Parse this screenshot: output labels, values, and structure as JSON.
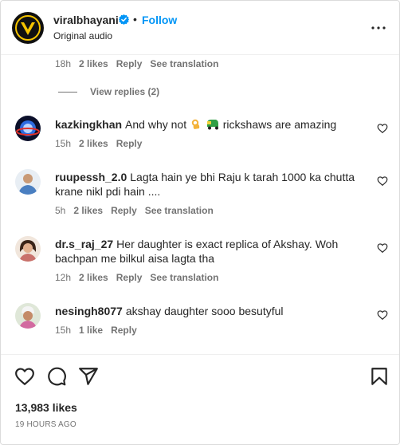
{
  "header": {
    "username": "viralbhayani",
    "separator": "•",
    "follow_label": "Follow",
    "audio": "Original audio",
    "colors": {
      "follow": "#0095f6",
      "verified": "#0095f6"
    }
  },
  "top_meta": {
    "time": "18h",
    "likes": "2 likes",
    "reply": "Reply",
    "translate": "See translation"
  },
  "view_replies": "View replies (2)",
  "comments": [
    {
      "username": "kazkingkhan",
      "text_before": "And why not",
      "text_after": "rickshaws are amazing",
      "emojis": [
        "ok-hand-emoji",
        "auto-rickshaw-emoji"
      ],
      "time": "15h",
      "likes": "2 likes",
      "reply": "Reply"
    },
    {
      "username": "ruupessh_2.0",
      "text_line1": "Lagta hain ye bhi Raju k tarah 1000 ka chutta",
      "text_line2": "krane nikl pdi hain ....",
      "time": "5h",
      "likes": "2 likes",
      "reply": "Reply",
      "translate": "See translation"
    },
    {
      "username": "dr.s_raj_27",
      "text_line1": "Her daughter is exact replica of Akshay. Woh",
      "text_line2": "bachpan me bilkul aisa lagta tha",
      "time": "12h",
      "likes": "2 likes",
      "reply": "Reply",
      "translate": "See translation"
    },
    {
      "username": "nesingh8077",
      "text": "akshay daughter sooo besutyful",
      "time": "15h",
      "likes": "1 like",
      "reply": "Reply"
    }
  ],
  "actions": {
    "icons": [
      "heart-icon",
      "comment-icon",
      "share-icon",
      "bookmark-icon"
    ],
    "likes_count": "13,983 likes",
    "time_ago": "19 HOURS AGO"
  }
}
